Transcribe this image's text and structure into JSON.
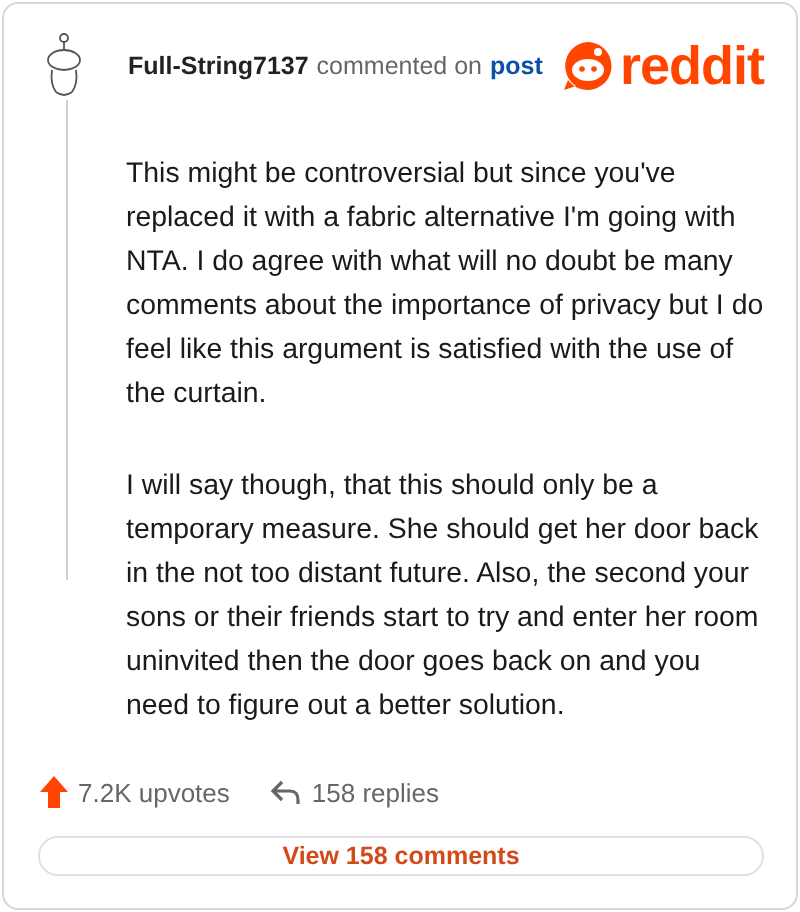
{
  "comment": {
    "author": "Full-String7137",
    "action": "commented on",
    "target": "post",
    "paragraphs": [
      "This might be controversial but since you've replaced it with a fabric alternative I'm going with NTA. I do agree with what will no doubt be many comments about the importance of privacy but I do feel like this argument is satisfied with the use of the curtain.",
      "I will say though, that this should only be a temporary measure. She should get her door back in the not too distant future. Also, the second your sons or their friends start to try and enter her room uninvited then the door goes back on and you need to figure out a better solution."
    ]
  },
  "logo": {
    "text": "reddit"
  },
  "stats": {
    "upvotes": "7.2K upvotes",
    "replies": "158 replies"
  },
  "view_button": "View 158 comments"
}
